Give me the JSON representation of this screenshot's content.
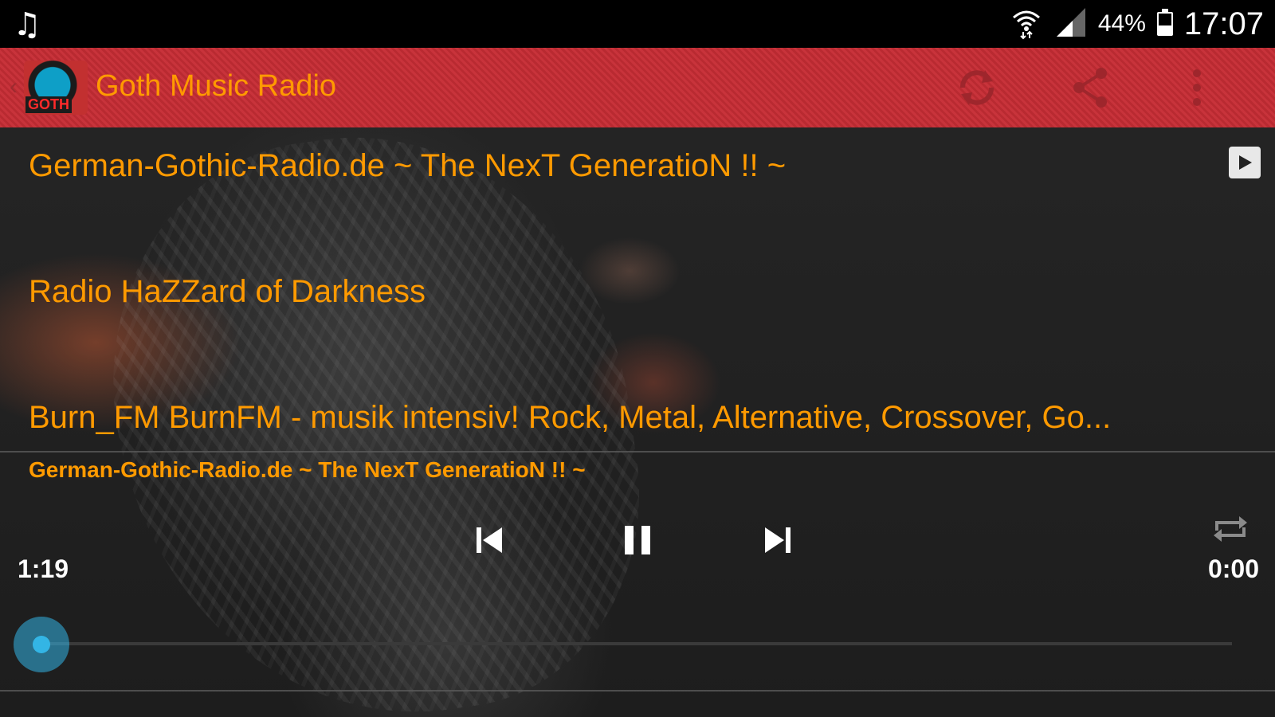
{
  "status_bar": {
    "battery_percent": "44%",
    "battery_level": 0.44,
    "time": "17:07",
    "icons": [
      "music-note-icon",
      "wifi-icon",
      "cell-signal-icon",
      "battery-icon"
    ]
  },
  "action_bar": {
    "logo_text": "GOTH",
    "title": "Goth Music Radio",
    "icons": [
      "refresh-icon",
      "share-icon",
      "overflow-menu-icon"
    ]
  },
  "stations": [
    {
      "name": "German-Gothic-Radio.de ~ The NexT GeneratioN !! ~"
    },
    {
      "name": "Radio HaZZard of Darkness"
    },
    {
      "name": "Burn_FM BurnFM - musik intensiv! Rock, Metal, Alternative, Crossover, Go..."
    }
  ],
  "player": {
    "now_playing": "German-Gothic-Radio.de ~ The NexT GeneratioN !! ~",
    "elapsed": "1:19",
    "duration": "0:00",
    "progress": 0,
    "controls": [
      "previous-icon",
      "pause-icon",
      "next-icon",
      "repeat-icon"
    ]
  },
  "colors": {
    "accent": "#ff9a00",
    "action_bar": "#c8333b",
    "seek": "#33b5e5"
  }
}
